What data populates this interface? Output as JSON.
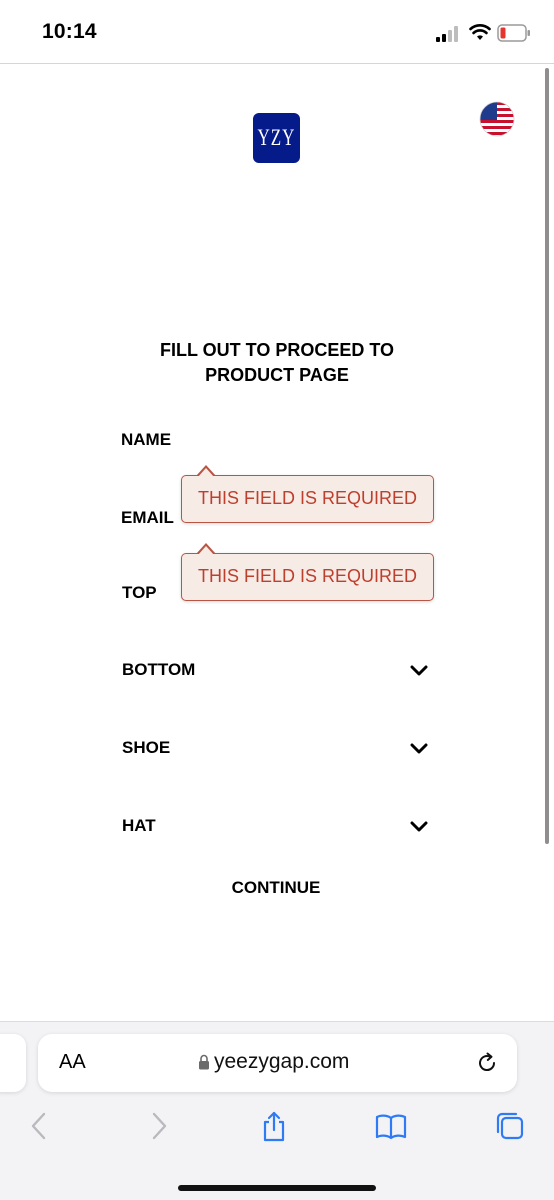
{
  "status_bar": {
    "time": "10:14"
  },
  "header": {
    "logo_text": "YZY",
    "flag_icon": "us-flag-icon"
  },
  "form": {
    "title": "FILL OUT TO PROCEED TO PRODUCT PAGE",
    "fields": {
      "name": "NAME",
      "email": "EMAIL",
      "top": "TOP",
      "bottom": "BOTTOM",
      "shoe": "SHOE",
      "hat": "HAT"
    },
    "errors": {
      "name": "THIS FIELD IS REQUIRED",
      "email": "THIS FIELD IS REQUIRED"
    },
    "continue_label": "CONTINUE"
  },
  "browser": {
    "aa_label": "AA",
    "url": "yeezygap.com"
  },
  "colors": {
    "logo_bg": "#061b8a",
    "error_text": "#bd3f2d",
    "error_bg": "#f7ebe6",
    "accent": "#2f7bf6"
  }
}
